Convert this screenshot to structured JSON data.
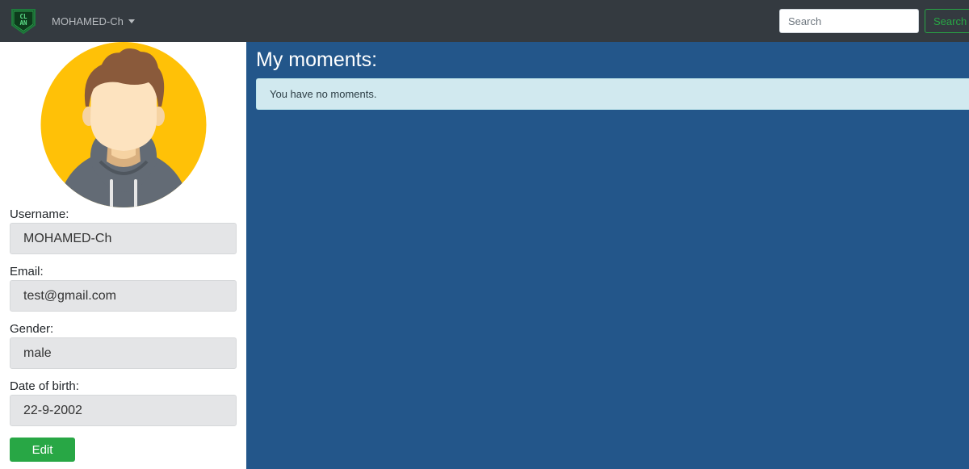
{
  "navbar": {
    "logo_icon": "clan-shield-logo",
    "logo_text": "CLAN",
    "user_menu_label": "MOHAMED-Ch",
    "search_placeholder": "Search",
    "search_button": "Search"
  },
  "profile": {
    "avatar_icon": "user-avatar",
    "fields": [
      {
        "label": "Username:",
        "value": "MOHAMED-Ch"
      },
      {
        "label": "Email:",
        "value": "test@gmail.com"
      },
      {
        "label": "Gender:",
        "value": "male"
      },
      {
        "label": "Date of birth:",
        "value": "22-9-2002"
      }
    ],
    "edit_button": "Edit"
  },
  "main": {
    "title": "My moments:",
    "empty_message": "You have no moments."
  },
  "colors": {
    "navbar_bg": "#343a40",
    "main_bg": "#23568a",
    "accent_green": "#28a745",
    "alert_bg": "#d1e9ef",
    "avatar_bg": "#ffc107"
  }
}
